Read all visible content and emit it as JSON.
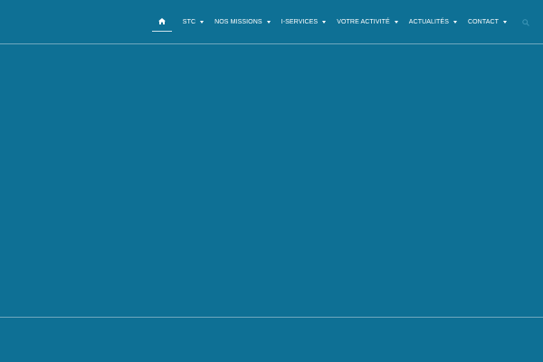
{
  "nav": {
    "home_icon": "home-icon",
    "items": [
      {
        "label": "STC"
      },
      {
        "label": "NOS MISSIONS"
      },
      {
        "label": "I-SERVICES"
      },
      {
        "label": "VOTRE ACTIVITÉ"
      },
      {
        "label": "ACTUALITÉS"
      },
      {
        "label": "CONTACT"
      }
    ],
    "search_icon": "search-icon"
  },
  "colors": {
    "background": "#0e7095",
    "divider": "#6fa7bd",
    "text": "#ffffff"
  }
}
